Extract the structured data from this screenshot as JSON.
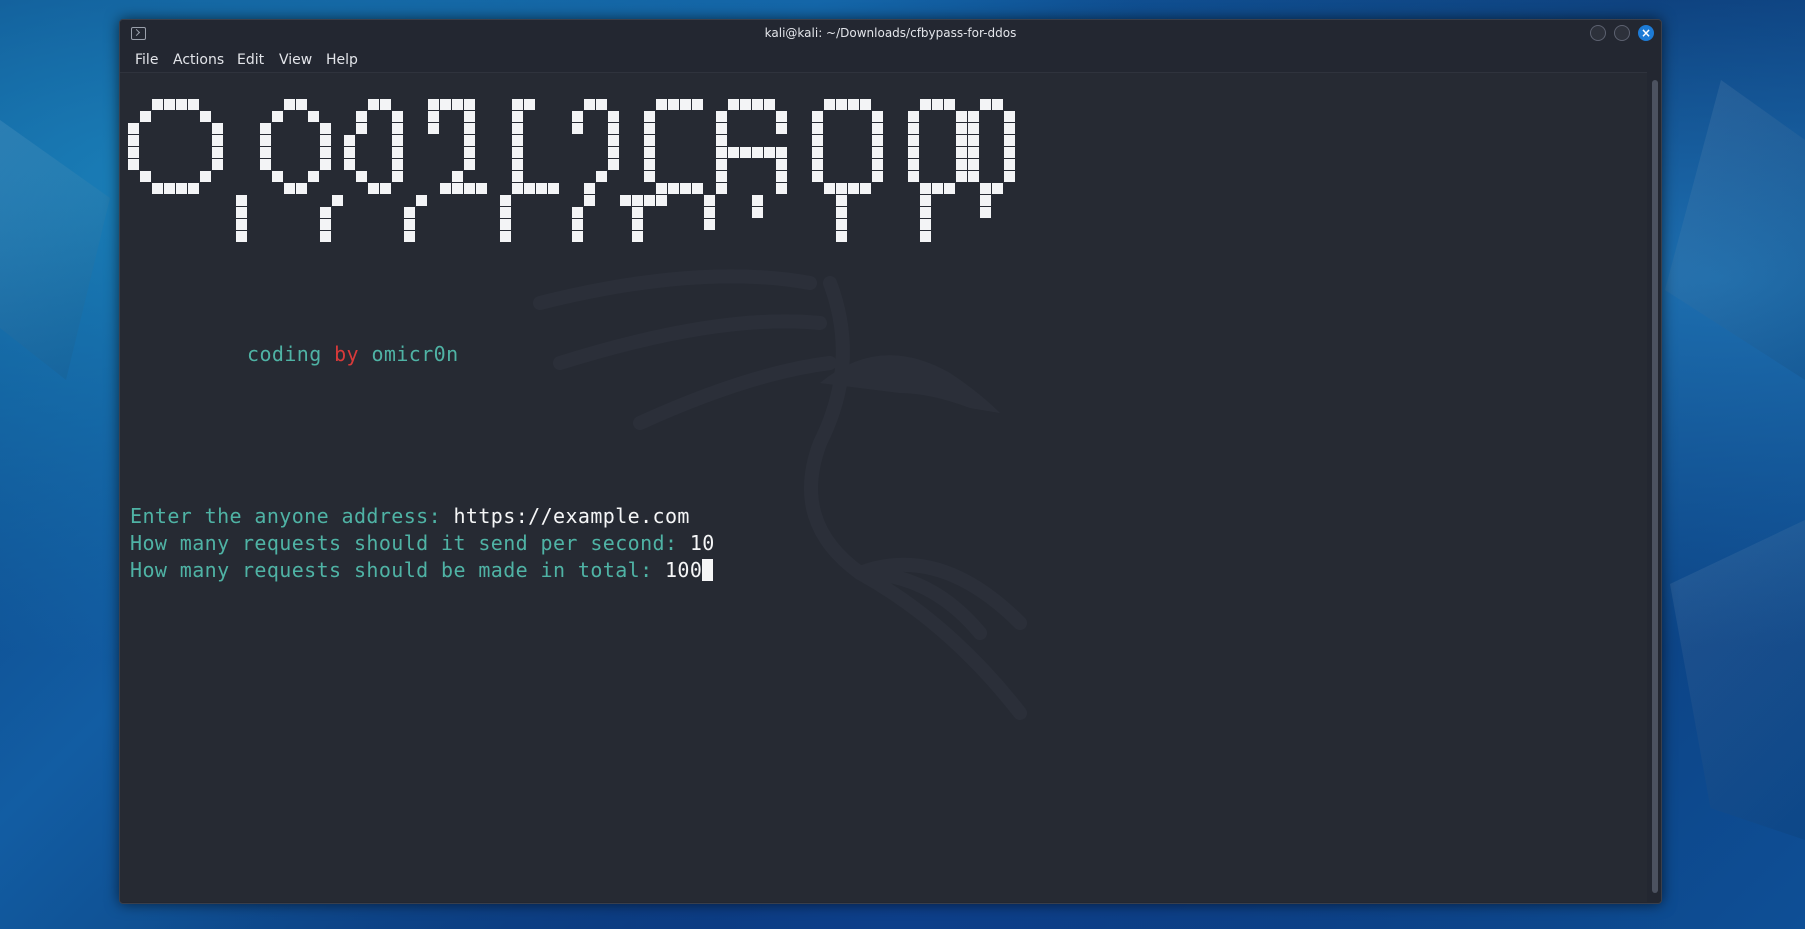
{
  "window": {
    "title": "kali@kali: ~/Downloads/cfbypass-for-ddos"
  },
  "menu": {
    "file": "File",
    "actions": "Actions",
    "edit": "Edit",
    "view": "View",
    "help": "Help"
  },
  "terminal": {
    "banner_text": "OMICR0N",
    "credit": {
      "part1": "coding",
      "part2": "by",
      "part3": "omicr0n"
    },
    "prompts": [
      {
        "label": "Enter the anyone address:",
        "value": "https://example.com"
      },
      {
        "label": "How many requests should it send per second:",
        "value": "10"
      },
      {
        "label": "How many requests should be made in total:",
        "value": "100"
      }
    ]
  },
  "colors": {
    "prompt": "#4fb3a5",
    "accent_red": "#d83a3a",
    "input": "#f5f6f7",
    "background": "#262a33"
  },
  "icons": [
    "terminal-icon",
    "minimize-icon",
    "maximize-icon",
    "close-icon",
    "kali-dragon-icon"
  ]
}
